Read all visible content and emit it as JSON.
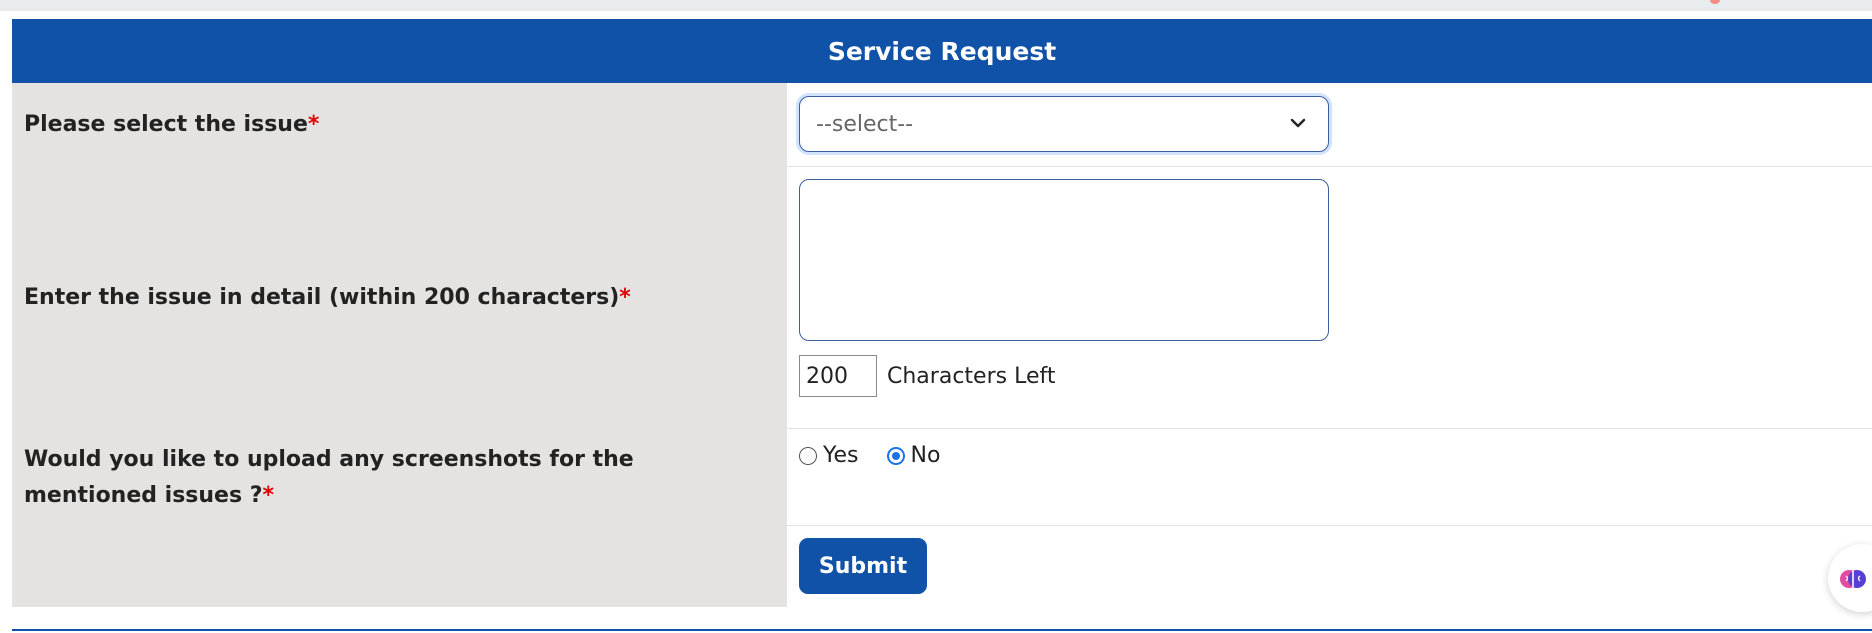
{
  "form": {
    "title": "Service Request",
    "issue_label": "Please select the issue",
    "issue_select_value": "--select--",
    "detail_label": "Enter the issue in detail (within 200 characters)",
    "detail_value": "",
    "chars_left_value": "200",
    "chars_left_label": "Characters Left",
    "upload_label_line1": "Would you like to upload any screenshots for the",
    "upload_label_line2": "mentioned issues ?",
    "required_mark": "*",
    "radio_yes_label": "Yes",
    "radio_no_label": "No",
    "radio_selected": "No",
    "submit_label": "Submit"
  },
  "colors": {
    "header_bg": "#0f52a8",
    "label_bg": "#e4e3e2",
    "required": "#e00000",
    "radio_checked": "#1a73e8"
  },
  "icons": {
    "select_chevron": "chevron-down-icon",
    "assistant": "brain-icon"
  }
}
